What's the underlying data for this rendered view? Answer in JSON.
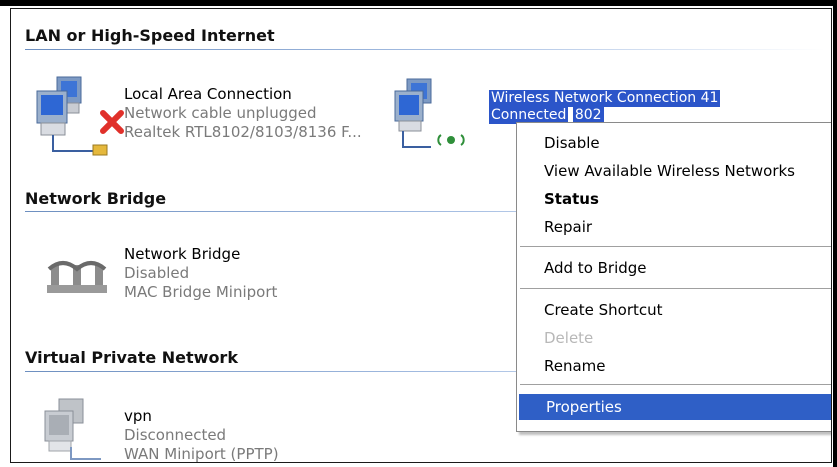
{
  "sections": [
    {
      "title": "LAN or High-Speed Internet"
    },
    {
      "title": "Network Bridge"
    },
    {
      "title": "Virtual Private Network"
    }
  ],
  "connections": {
    "local": {
      "name": "Local Area Connection",
      "status": "Network cable unplugged",
      "device": "Realtek RTL8102/8103/8136 F..."
    },
    "wireless": {
      "name": "Wireless Network Connection 41",
      "status": "Connected",
      "device": "802"
    },
    "bridge": {
      "name": "Network Bridge",
      "status": "Disabled",
      "device": "MAC Bridge Miniport"
    },
    "vpn": {
      "name": "vpn",
      "status": "Disconnected",
      "device": "WAN Miniport (PPTP)"
    }
  },
  "context_menu": {
    "items": [
      {
        "label": "Disable"
      },
      {
        "label": "View Available Wireless Networks"
      },
      {
        "label": "Status"
      },
      {
        "label": "Repair"
      },
      {
        "label": "Add to Bridge"
      },
      {
        "label": "Create Shortcut"
      },
      {
        "label": "Delete"
      },
      {
        "label": "Rename"
      },
      {
        "label": "Properties"
      }
    ]
  },
  "icons": {
    "lan": "network-computer-icon",
    "unplugged": "red-x-icon",
    "wireless": "wireless-computer-icon",
    "bridge": "network-bridge-icon",
    "vpn": "vpn-computer-icon"
  },
  "colors": {
    "selection": "#2f5fc6",
    "highlight": "#2b55c9",
    "disabled_text": "#b8b8b8"
  }
}
